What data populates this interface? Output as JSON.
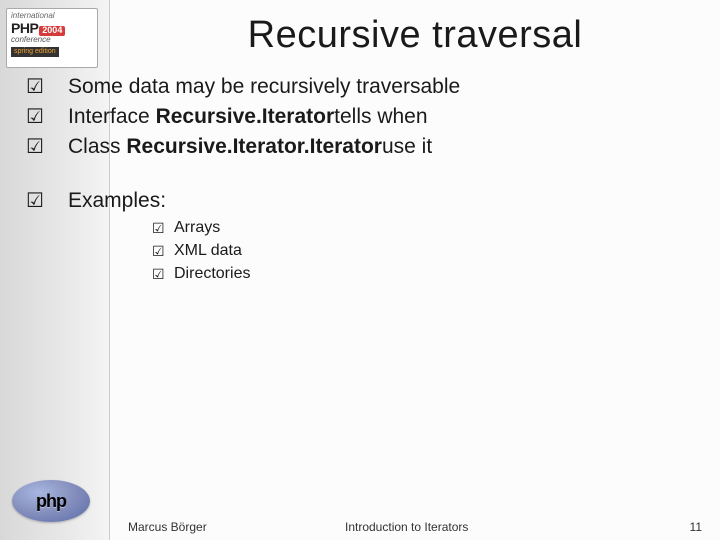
{
  "logo": {
    "line1": "international",
    "php": "PHP",
    "year": "2004",
    "conference": "conference",
    "edition": "spring edition"
  },
  "phpLogo": {
    "text": "php"
  },
  "title": "Recursive traversal",
  "bullets": [
    {
      "pre": "Some data may be recursively traversable",
      "bold": "",
      "post": ""
    },
    {
      "pre": "Interface ",
      "bold": "Recursive.Iterator",
      "post": "tells when"
    },
    {
      "pre": "Class ",
      "bold": "Recursive.Iterator.Iterator",
      "post": "use it"
    }
  ],
  "examplesLabel": "Examples:",
  "examples": [
    "Arrays",
    "XML data",
    "Directories"
  ],
  "footer": {
    "author": "Marcus Börger",
    "topic": "Introduction to Iterators",
    "page": "11"
  },
  "glyphs": {
    "check": "☑"
  }
}
